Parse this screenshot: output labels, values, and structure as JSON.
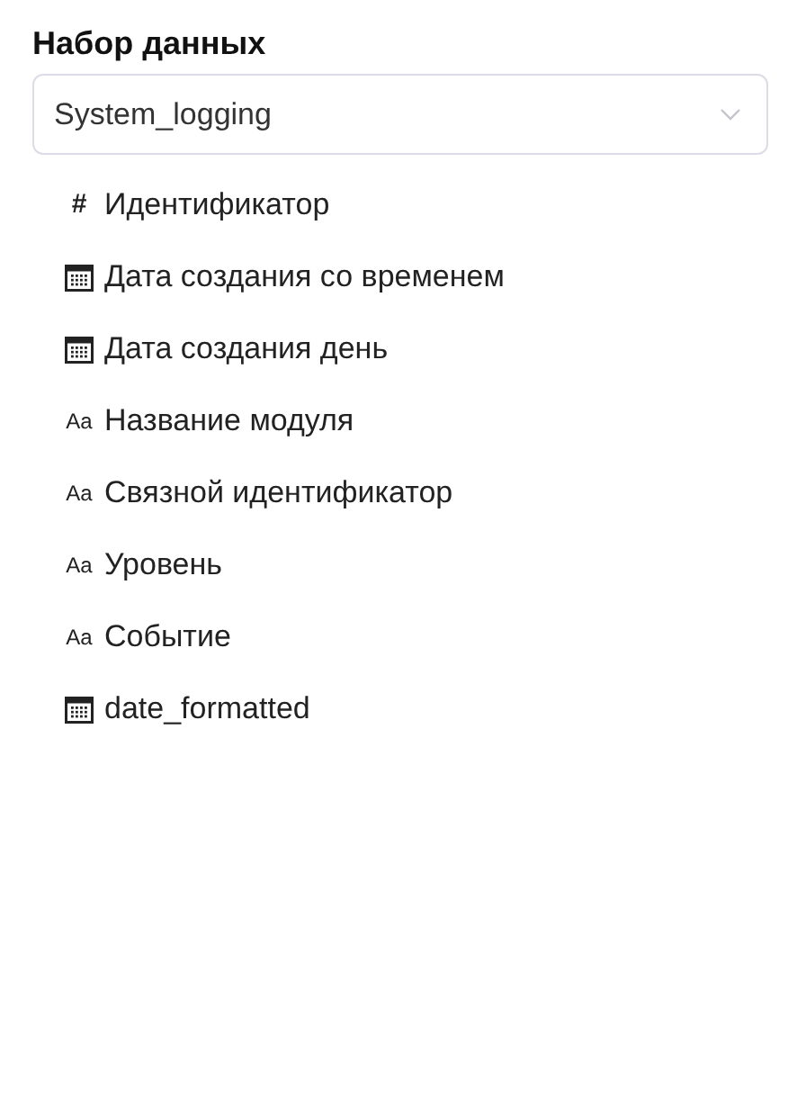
{
  "title": "Набор данных",
  "dataset_select": {
    "value": "System_logging"
  },
  "fields": [
    {
      "kind": "number",
      "icon_text": "#",
      "label": "Идентификатор"
    },
    {
      "kind": "date",
      "label": "Дата создания со временем"
    },
    {
      "kind": "date",
      "label": "Дата создания день"
    },
    {
      "kind": "text",
      "icon_text": "Aa",
      "label": "Название модуля"
    },
    {
      "kind": "text",
      "icon_text": "Aa",
      "label": "Связной идентификатор"
    },
    {
      "kind": "text",
      "icon_text": "Aa",
      "label": "Уровень"
    },
    {
      "kind": "text",
      "icon_text": "Aa",
      "label": "Событие"
    },
    {
      "kind": "date",
      "label": "date_formatted"
    }
  ]
}
